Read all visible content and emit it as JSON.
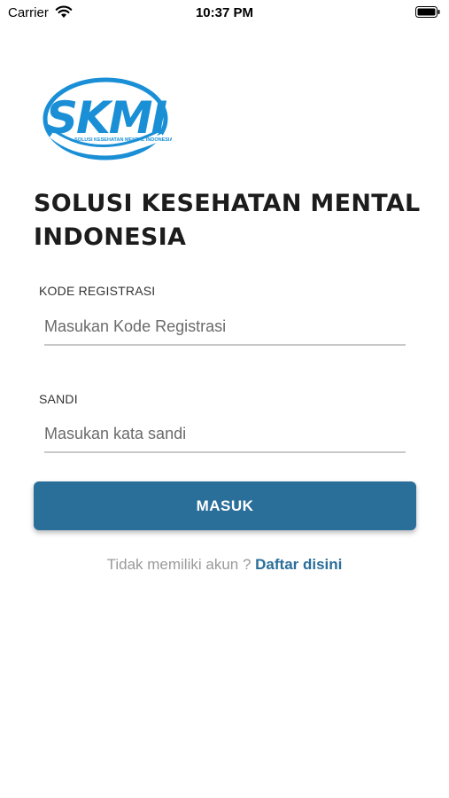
{
  "status_bar": {
    "carrier": "Carrier",
    "time": "10:37 PM"
  },
  "logo": {
    "text": "SKMI",
    "tagline": "SOLUSI KESEHATAN MENTAL INDONESIA",
    "color": "#1a8fd6"
  },
  "title": "SOLUSI KESEHATAN MENTAL INDONESIA",
  "form": {
    "registration_code": {
      "label": "KODE REGISTRASI",
      "placeholder": "Masukan Kode Registrasi",
      "value": ""
    },
    "password": {
      "label": "SANDI",
      "placeholder": "Masukan kata sandi",
      "value": ""
    },
    "submit_label": "MASUK"
  },
  "register": {
    "prompt": "Tidak memiliki akun ?",
    "link": "Daftar disini"
  },
  "colors": {
    "primary": "#2a6e9a",
    "logo_blue": "#1a8fd6",
    "divider": "#c9c9c9"
  }
}
